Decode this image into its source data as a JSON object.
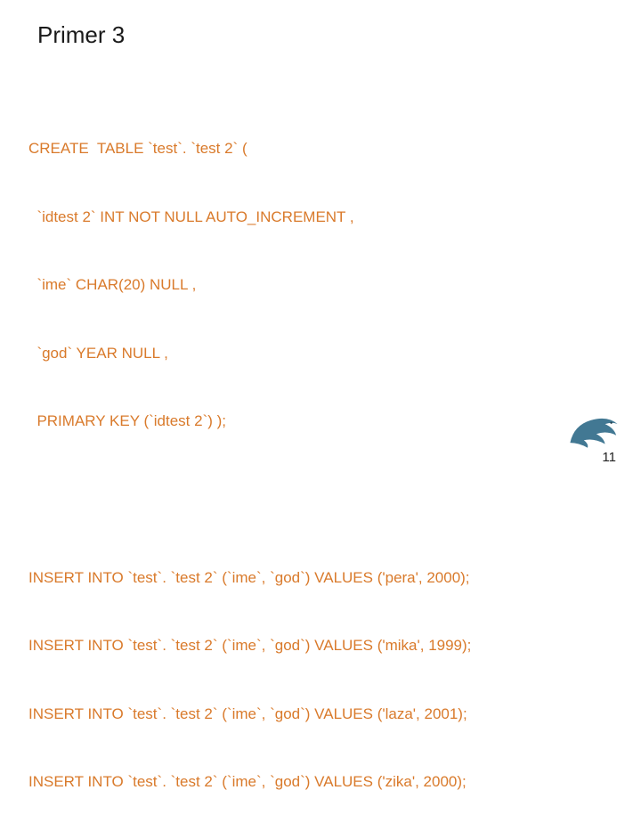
{
  "title": "Primer 3",
  "code": {
    "create": [
      "CREATE  TABLE `test`. `test 2` (",
      "  `idtest 2` INT NOT NULL AUTO_INCREMENT ,",
      "  `ime` CHAR(20) NULL ,",
      "  `god` YEAR NULL ,",
      "  PRIMARY KEY (`idtest 2`) );"
    ],
    "inserts": [
      "INSERT INTO `test`. `test 2` (`ime`, `god`) VALUES ('pera', 2000);",
      "INSERT INTO `test`. `test 2` (`ime`, `god`) VALUES ('mika', 1999);",
      "INSERT INTO `test`. `test 2` (`ime`, `god`) VALUES ('laza', 2001);",
      "INSERT INTO `test`. `test 2` (`ime`, `god`) VALUES ('zika', 2000);"
    ]
  },
  "page_number": "11",
  "logo_name": "dolphin-logo"
}
